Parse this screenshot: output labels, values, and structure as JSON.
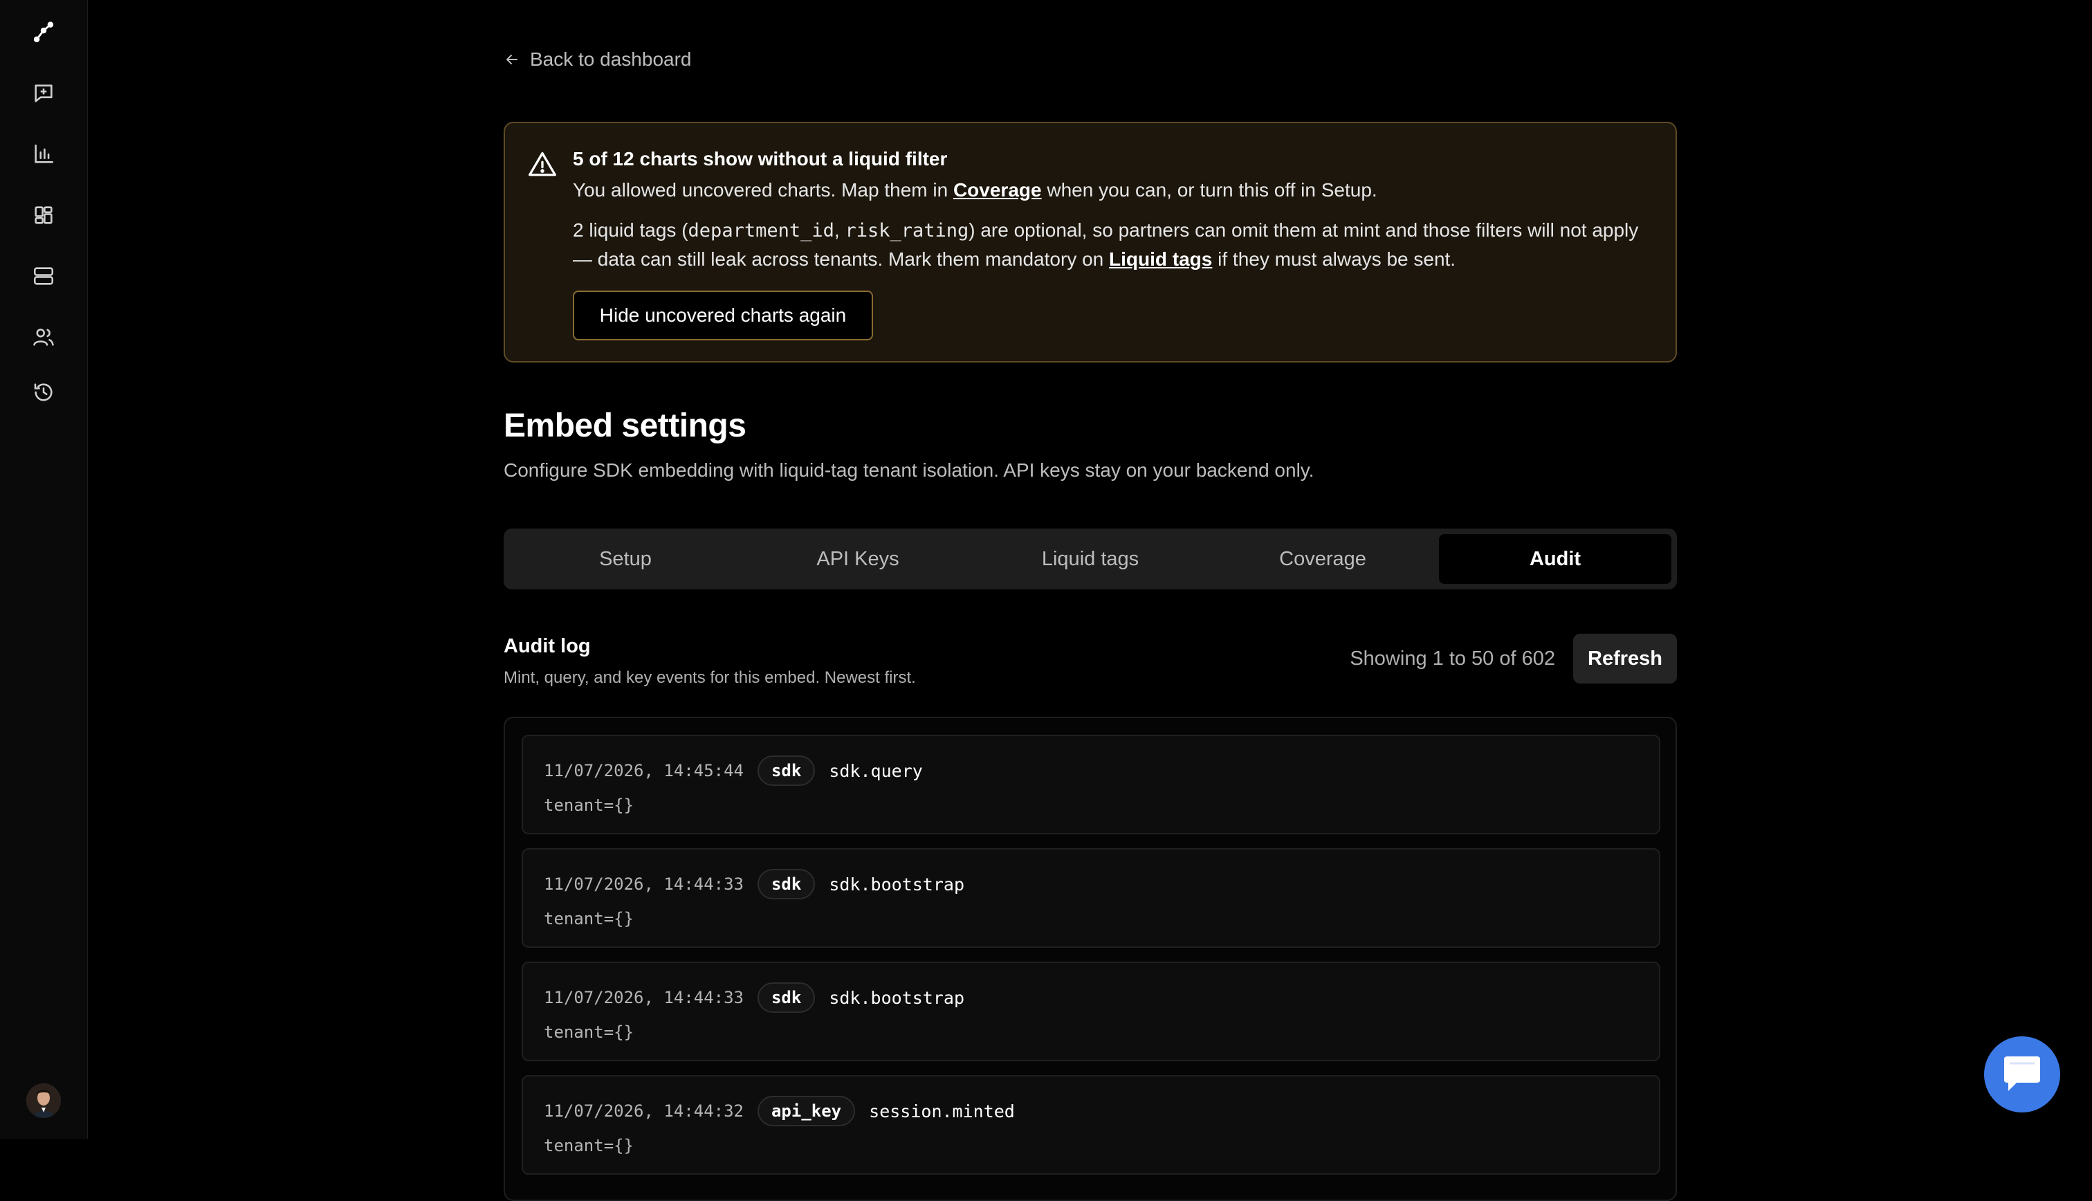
{
  "sidebar": {
    "icons": [
      "graph-nodes-icon",
      "message-plus-icon",
      "bar-chart-icon",
      "dashboard-grid-icon",
      "database-icon",
      "users-icon",
      "history-icon"
    ],
    "avatar": "user-avatar"
  },
  "back_link": {
    "label": "Back to dashboard"
  },
  "warning": {
    "title": "5 of 12 charts show without a liquid filter",
    "line1_pre": "You allowed uncovered charts. Map them in ",
    "line1_link": "Coverage",
    "line1_post": " when you can, or turn this off in Setup.",
    "line2_pre": "2 liquid tags (",
    "line2_tag1": "department_id",
    "line2_sep": ", ",
    "line2_tag2": "risk_rating",
    "line2_mid": ") are optional, so partners can omit them at mint and those filters will not apply — data can still leak across tenants. Mark them mandatory on ",
    "line2_link": "Liquid tags",
    "line2_post": " if they must always be sent.",
    "button": "Hide uncovered charts again"
  },
  "page": {
    "title": "Embed settings",
    "subtitle": "Configure SDK embedding with liquid-tag tenant isolation. API keys stay on your backend only."
  },
  "tabs": [
    {
      "label": "Setup",
      "active": false
    },
    {
      "label": "API Keys",
      "active": false
    },
    {
      "label": "Liquid tags",
      "active": false
    },
    {
      "label": "Coverage",
      "active": false
    },
    {
      "label": "Audit",
      "active": true
    }
  ],
  "audit": {
    "title": "Audit log",
    "subtitle": "Mint, query, and key events for this embed. Newest first.",
    "showing": "Showing 1 to 50 of 602",
    "refresh": "Refresh",
    "entries": [
      {
        "time": "11/07/2026, 14:45:44",
        "source": "sdk",
        "event": "sdk.query",
        "detail": "tenant={}"
      },
      {
        "time": "11/07/2026, 14:44:33",
        "source": "sdk",
        "event": "sdk.bootstrap",
        "detail": "tenant={}"
      },
      {
        "time": "11/07/2026, 14:44:33",
        "source": "sdk",
        "event": "sdk.bootstrap",
        "detail": "tenant={}"
      },
      {
        "time": "11/07/2026, 14:44:32",
        "source": "api_key",
        "event": "session.minted",
        "detail": "tenant={}"
      }
    ]
  },
  "colors": {
    "accent_warning_border": "#5e4a25",
    "chat_button": "#3b7ae6"
  },
  "chat": {
    "icon": "chat-bubble-icon"
  }
}
